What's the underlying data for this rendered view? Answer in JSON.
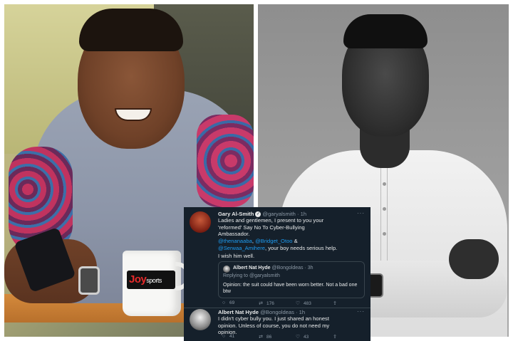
{
  "photo_left": {
    "mug_logo_main": "Joy",
    "mug_logo_sub": "sports"
  },
  "tweet_card": {
    "tweet1": {
      "name": "Gary Al-Smith",
      "verified_icon": "verified-badge-icon",
      "handle": "@garyalsmith",
      "time": "· 1h",
      "line1": "Ladies and gentlemen, I present to you your",
      "line2": "'reformed' Say No To Cyber-Bullying",
      "line3": "Ambassador.",
      "mention1": "@thenanaaba",
      "sep1": ", ",
      "mention2": "@Bridget_Otoo",
      "sep2": " &",
      "mention3": "@Serwaa_Amihere",
      "tail": ", your boy needs serious help.",
      "wish": "I wish him well.",
      "quote": {
        "name": "Albert Nat Hyde",
        "handle": "@Bongoldeas",
        "time": "· 3h",
        "replying": "Replying to @garyalsmith",
        "body": "Opinion: the suit could have been worn better. Not a bad one btw"
      },
      "actions": {
        "replies": "69",
        "retweets": "176",
        "likes": "483"
      }
    },
    "tweet2": {
      "name": "Albert Nat Hyde",
      "handle": "@Bongoldeas",
      "time": "· 1h",
      "line1": "I didn't cyber bully you. I just shared an honest",
      "line2": "opinion. Unless of course, you do not need my",
      "line3": "opinion.",
      "actions": {
        "replies": "41",
        "retweets": "86",
        "likes": "43"
      }
    },
    "icons": {
      "more": "···",
      "reply": "○",
      "retweet": "⇄",
      "like": "♡",
      "share": "⇪"
    },
    "colors": {
      "background": "#15202b",
      "text": "#e7e9ea",
      "muted": "#8b98a5",
      "link": "#1d9bf0",
      "border": "#38444d"
    }
  }
}
